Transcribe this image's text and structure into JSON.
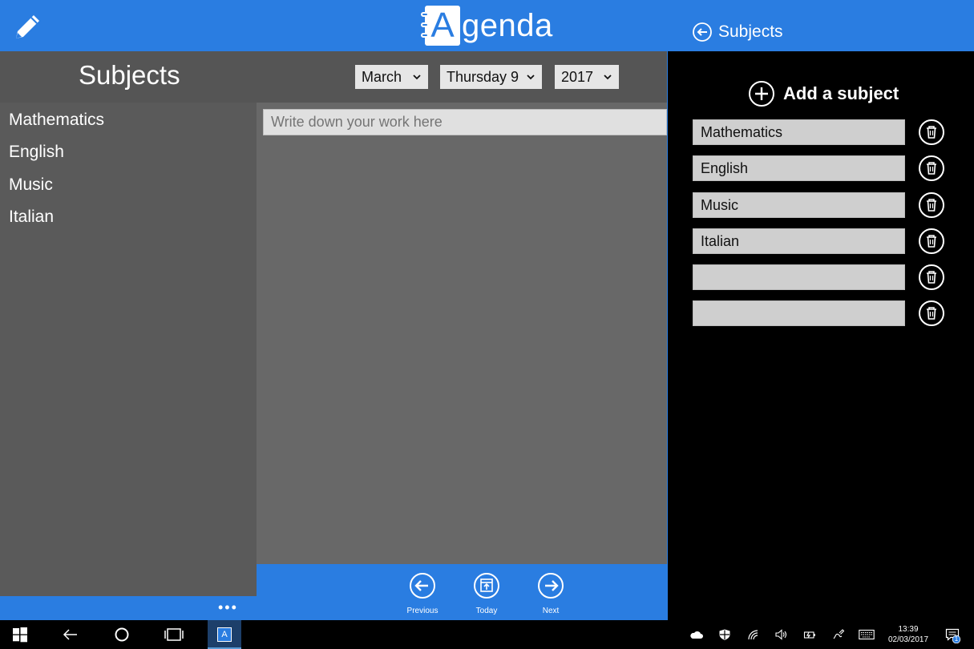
{
  "app": {
    "logo_letter": "A",
    "logo_rest": "genda",
    "title": "Subjects",
    "date": {
      "month": "March",
      "day": "Thursday 9",
      "year": "2017"
    },
    "subjects": [
      "Mathematics",
      "English",
      "Music",
      "Italian"
    ],
    "work_placeholder": "Write down your work here",
    "more_label": "•••",
    "nav": {
      "previous": "Previous",
      "today": "Today",
      "next": "Next"
    }
  },
  "flyout": {
    "title": "Subjects",
    "add_label": "Add a subject",
    "fields": [
      "Mathematics",
      "English",
      "Music",
      "Italian",
      "",
      ""
    ]
  },
  "taskbar": {
    "app_icon_letter": "A",
    "time": "13:39",
    "date": "02/03/2017",
    "notification_count": "1"
  },
  "colors": {
    "accent": "#2a7de1",
    "panel": "#5a5a5a",
    "editor": "#686868"
  }
}
